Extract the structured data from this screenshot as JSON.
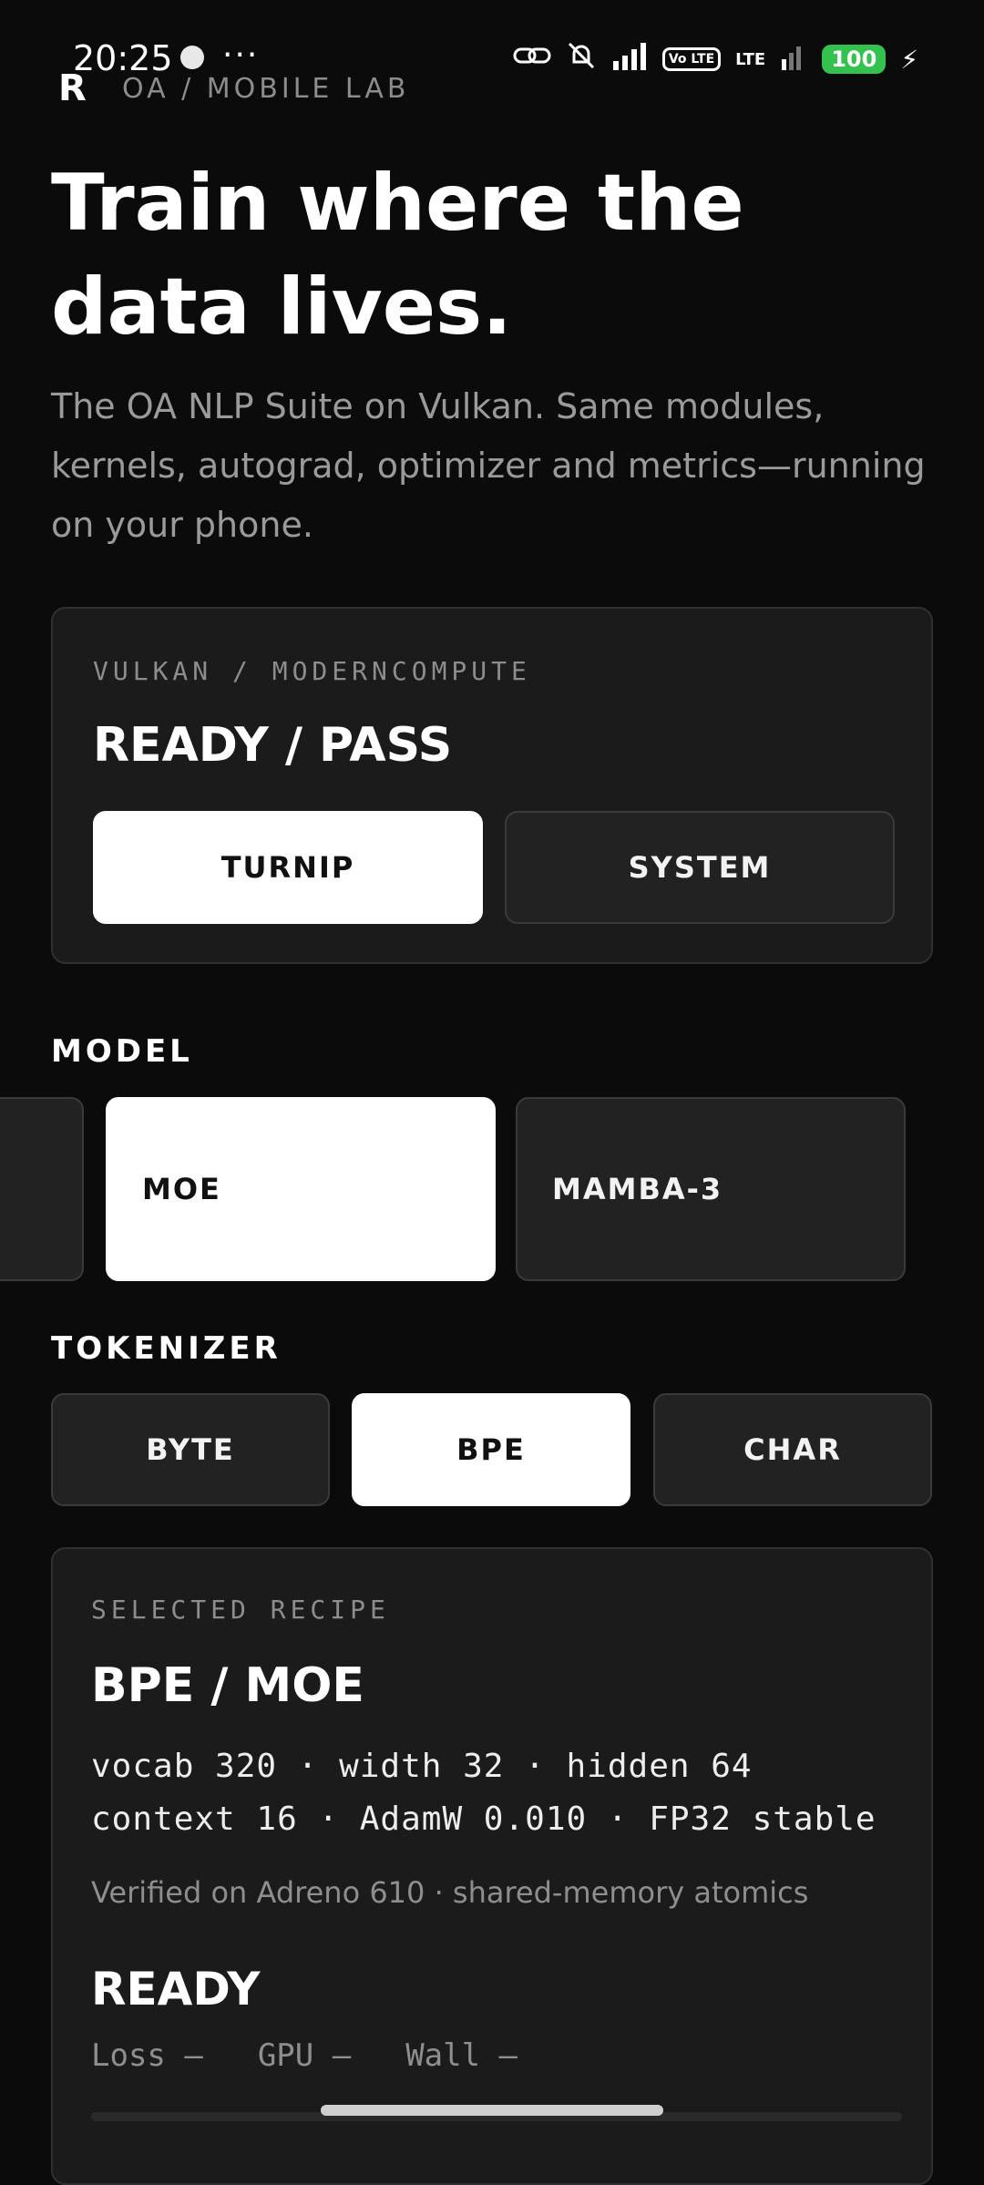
{
  "status_bar": {
    "time": "20:25",
    "more": "···",
    "volte": "Vo LTE",
    "lte": "LTE",
    "battery": "100",
    "icons": [
      "notification-dot-icon",
      "link-icon",
      "mute-icon",
      "signal-icon",
      "volte-icon",
      "lte-signal-icon",
      "battery-icon",
      "charging-icon"
    ]
  },
  "brand": {
    "logo": "R",
    "label": "OA / MOBILE LAB"
  },
  "hero": {
    "title": "Train where the data lives.",
    "description": "The OA NLP Suite on Vulkan. Same modules, kernels, autograd, optimizer and metrics—running on your phone."
  },
  "backend_card": {
    "kicker": "VULKAN / MODERNCOMPUTE",
    "status": "READY / PASS",
    "options": [
      "TURNIP",
      "SYSTEM"
    ],
    "selected": "TURNIP"
  },
  "model": {
    "label": "MODEL",
    "options": [
      "MOE",
      "MAMBA-3"
    ],
    "selected": "MOE"
  },
  "tokenizer": {
    "label": "TOKENIZER",
    "options": [
      "BYTE",
      "BPE",
      "CHAR"
    ],
    "selected": "BPE"
  },
  "recipe": {
    "kicker": "SELECTED RECIPE",
    "title": "BPE / MOE",
    "spec_line1": "vocab 320 · width 32 · hidden 64",
    "spec_line2": "context 16 · AdamW 0.010 · FP32 stable",
    "verified": "Verified on Adreno 610 · shared-memory atomics",
    "state": "READY",
    "metrics": {
      "loss": "Loss –",
      "gpu": "GPU –",
      "wall": "Wall –"
    }
  },
  "colors": {
    "background": "#0b0b0b",
    "card": "#1b1b1b",
    "selected": "#ffffff",
    "battery": "#33c24d"
  }
}
